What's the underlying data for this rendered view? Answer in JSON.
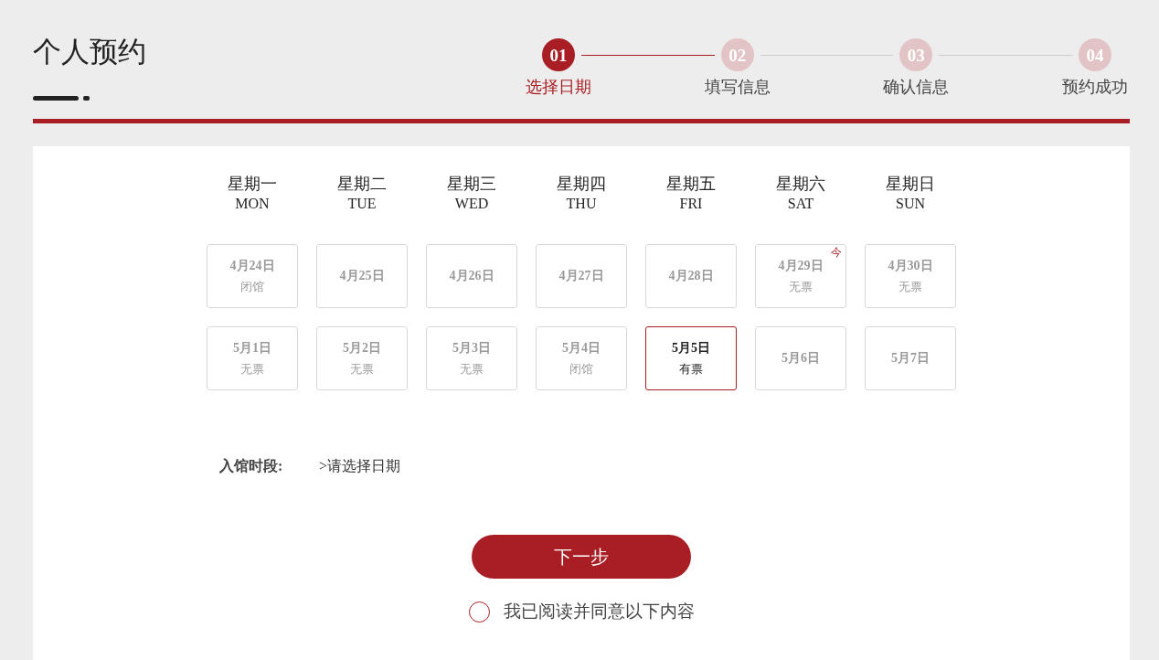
{
  "page_title": "个人预约",
  "steps": [
    {
      "number": "01",
      "label": "选择日期",
      "active": true
    },
    {
      "number": "02",
      "label": "填写信息",
      "active": false
    },
    {
      "number": "03",
      "label": "确认信息",
      "active": false
    },
    {
      "number": "04",
      "label": "预约成功",
      "active": false
    }
  ],
  "calendar": {
    "weekdays": [
      {
        "name": "星期一",
        "abbr": "MON"
      },
      {
        "name": "星期二",
        "abbr": "TUE"
      },
      {
        "name": "星期三",
        "abbr": "WED"
      },
      {
        "name": "星期四",
        "abbr": "THU"
      },
      {
        "name": "星期五",
        "abbr": "FRI"
      },
      {
        "name": "星期六",
        "abbr": "SAT"
      },
      {
        "name": "星期日",
        "abbr": "SUN"
      }
    ],
    "weeks": [
      {
        "days": [
          {
            "date": "4月24日",
            "status": "闭馆",
            "selected": false
          },
          {
            "date": "4月25日",
            "selected": false
          },
          {
            "date": "4月26日",
            "selected": false
          },
          {
            "date": "4月27日",
            "selected": false
          },
          {
            "date": "4月28日",
            "selected": false
          },
          {
            "date": "4月29日",
            "status": "无票",
            "badge": "今",
            "selected": false
          },
          {
            "date": "4月30日",
            "status": "无票",
            "selected": false
          }
        ]
      },
      {
        "days": [
          {
            "date": "5月1日",
            "status": "无票",
            "selected": false
          },
          {
            "date": "5月2日",
            "status": "无票",
            "selected": false
          },
          {
            "date": "5月3日",
            "status": "无票",
            "selected": false
          },
          {
            "date": "5月4日",
            "status": "闭馆",
            "selected": false
          },
          {
            "date": "5月5日",
            "status": "有票",
            "selected": true
          },
          {
            "date": "5月6日",
            "selected": false
          },
          {
            "date": "5月7日",
            "selected": false
          }
        ]
      }
    ]
  },
  "time_slot": {
    "label": "入馆时段:",
    "value": ">请选择日期"
  },
  "next_button": "下一步",
  "agreement": {
    "label": "我已阅读并同意以下内容",
    "checked": false
  }
}
